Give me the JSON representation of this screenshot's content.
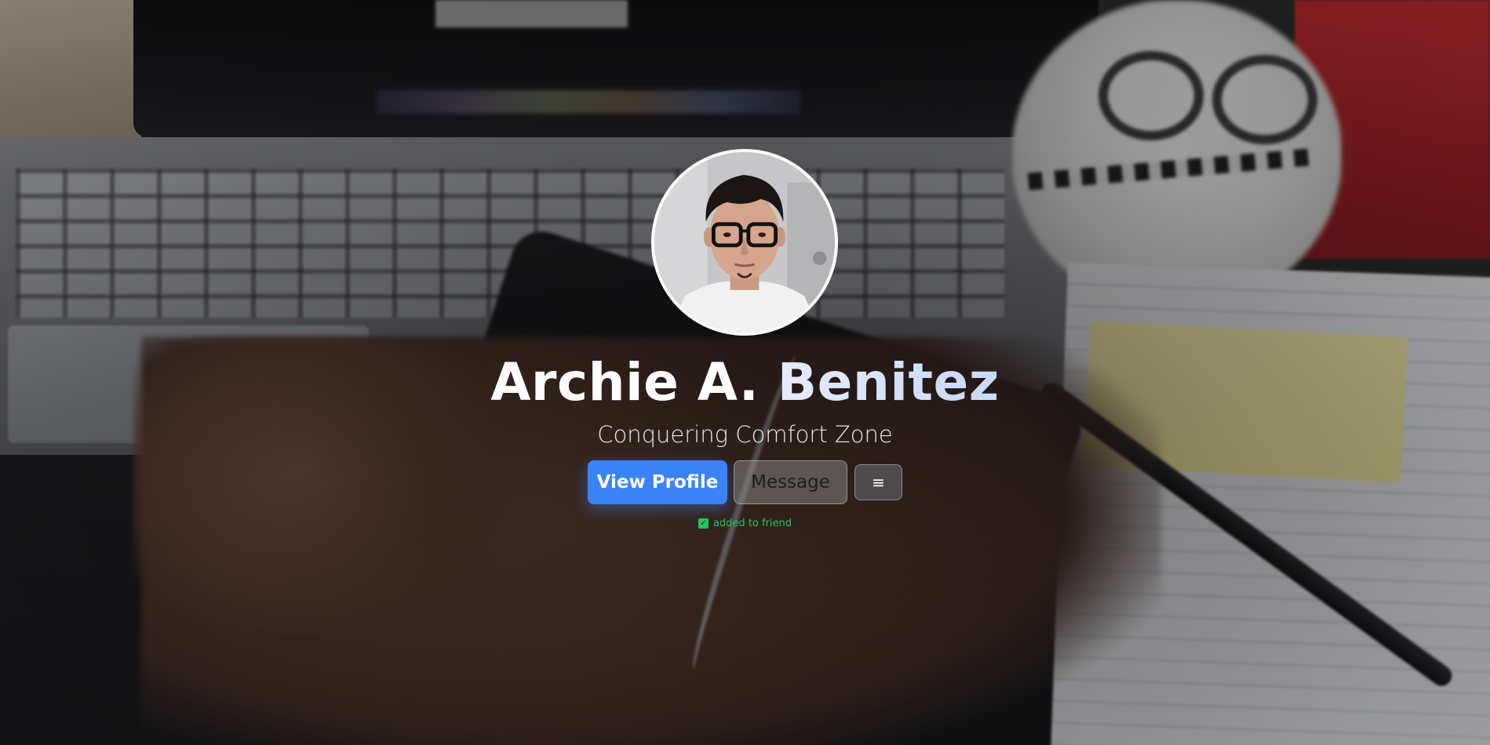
{
  "profile": {
    "first_name": "Archie A.",
    "last_name": "Benitez",
    "tagline": "Conquering Comfort Zone",
    "avatar_icon": "user-photo"
  },
  "actions": {
    "view_profile_label": "View Profile",
    "message_label": "Message",
    "menu_icon": "≡"
  },
  "status": {
    "text": "added to friend",
    "icon": "✓",
    "checked": true
  },
  "colors": {
    "primary_button": "#3b82f6",
    "status_green": "#22c55e",
    "name_gradient_start": "#e4ecff",
    "name_gradient_end": "#c9d8f7"
  }
}
